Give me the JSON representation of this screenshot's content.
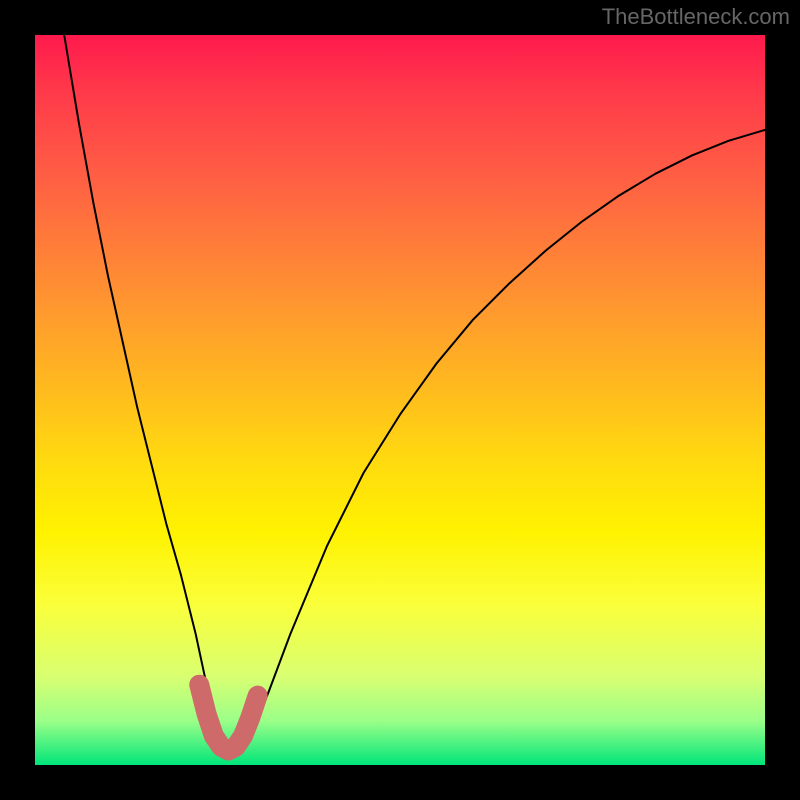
{
  "watermark": "TheBottleneck.com",
  "chart_data": {
    "type": "line",
    "title": "",
    "xlabel": "",
    "ylabel": "",
    "xlim": [
      0,
      100
    ],
    "ylim": [
      0,
      100
    ],
    "series": [
      {
        "name": "bottleneck-curve",
        "x": [
          4,
          6,
          8,
          10,
          12,
          14,
          16,
          18,
          20,
          22,
          23.5,
          25,
          26,
          27,
          28,
          30,
          32,
          35,
          40,
          45,
          50,
          55,
          60,
          65,
          70,
          75,
          80,
          85,
          90,
          95,
          100
        ],
        "values": [
          100,
          88,
          77,
          67,
          58,
          49,
          41,
          33,
          26,
          18,
          11,
          5,
          2.5,
          2,
          2.5,
          5,
          10,
          18,
          30,
          40,
          48,
          55,
          61,
          66,
          70.5,
          74.5,
          78,
          81,
          83.5,
          85.5,
          87
        ]
      }
    ],
    "highlight_zone": {
      "name": "optimal-range",
      "x": [
        22.5,
        23.5,
        24.5,
        25.5,
        26.5,
        27.5,
        28.5,
        29.5,
        30.5
      ],
      "values": [
        11,
        7,
        4,
        2.5,
        2,
        2.5,
        4,
        6.5,
        9.5
      ],
      "color": "#cf6a6a"
    },
    "background_gradient": {
      "stops": [
        {
          "pos": 0,
          "color": "#ff1a4d"
        },
        {
          "pos": 18,
          "color": "#ff5a45"
        },
        {
          "pos": 38,
          "color": "#ff9a2e"
        },
        {
          "pos": 58,
          "color": "#ffd910"
        },
        {
          "pos": 78,
          "color": "#faff3a"
        },
        {
          "pos": 94,
          "color": "#9aff88"
        },
        {
          "pos": 100,
          "color": "#00e57a"
        }
      ]
    }
  }
}
